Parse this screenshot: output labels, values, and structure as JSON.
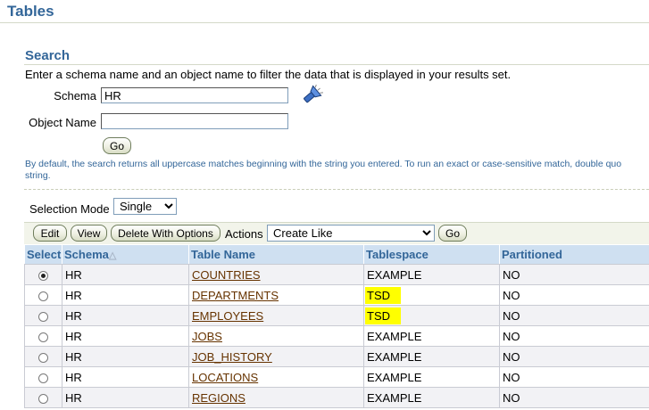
{
  "page": {
    "title": "Tables"
  },
  "search": {
    "title": "Search",
    "intro": "Enter a schema name and an object name to filter the data that is displayed in your results set.",
    "schema_label": "Schema",
    "schema_value": "HR",
    "object_label": "Object Name",
    "object_value": "",
    "go_label": "Go",
    "hint": "By default, the search returns all uppercase matches beginning with the string you entered. To run an exact or case-sensitive match, double quo",
    "hint_line2": "string."
  },
  "results": {
    "selection_mode_label": "Selection Mode",
    "selection_mode_value": "Single",
    "edit_label": "Edit",
    "view_label": "View",
    "delete_label": "Delete With Options",
    "actions_label": "Actions",
    "actions_value": "Create Like",
    "go_label": "Go",
    "columns": [
      "Select",
      "Schema",
      "Table Name",
      "Tablespace",
      "Partitioned"
    ],
    "sort_indicator": "△",
    "rows": [
      {
        "schema": "HR",
        "table": "COUNTRIES",
        "tablespace": "EXAMPLE",
        "partitioned": "NO",
        "selected": true,
        "highlight": false
      },
      {
        "schema": "HR",
        "table": "DEPARTMENTS",
        "tablespace": "TSD",
        "partitioned": "NO",
        "selected": false,
        "highlight": true
      },
      {
        "schema": "HR",
        "table": "EMPLOYEES",
        "tablespace": "TSD",
        "partitioned": "NO",
        "selected": false,
        "highlight": true
      },
      {
        "schema": "HR",
        "table": "JOBS",
        "tablespace": "EXAMPLE",
        "partitioned": "NO",
        "selected": false,
        "highlight": false
      },
      {
        "schema": "HR",
        "table": "JOB_HISTORY",
        "tablespace": "EXAMPLE",
        "partitioned": "NO",
        "selected": false,
        "highlight": false
      },
      {
        "schema": "HR",
        "table": "LOCATIONS",
        "tablespace": "EXAMPLE",
        "partitioned": "NO",
        "selected": false,
        "highlight": false
      },
      {
        "schema": "HR",
        "table": "REGIONS",
        "tablespace": "EXAMPLE",
        "partitioned": "NO",
        "selected": false,
        "highlight": false
      }
    ]
  },
  "colors": {
    "heading": "#336699",
    "link": "#663300",
    "highlight": "#ffff00",
    "header_bg": "#cfe0f1"
  },
  "icons": {
    "flashlight": "flashlight-search-icon"
  }
}
